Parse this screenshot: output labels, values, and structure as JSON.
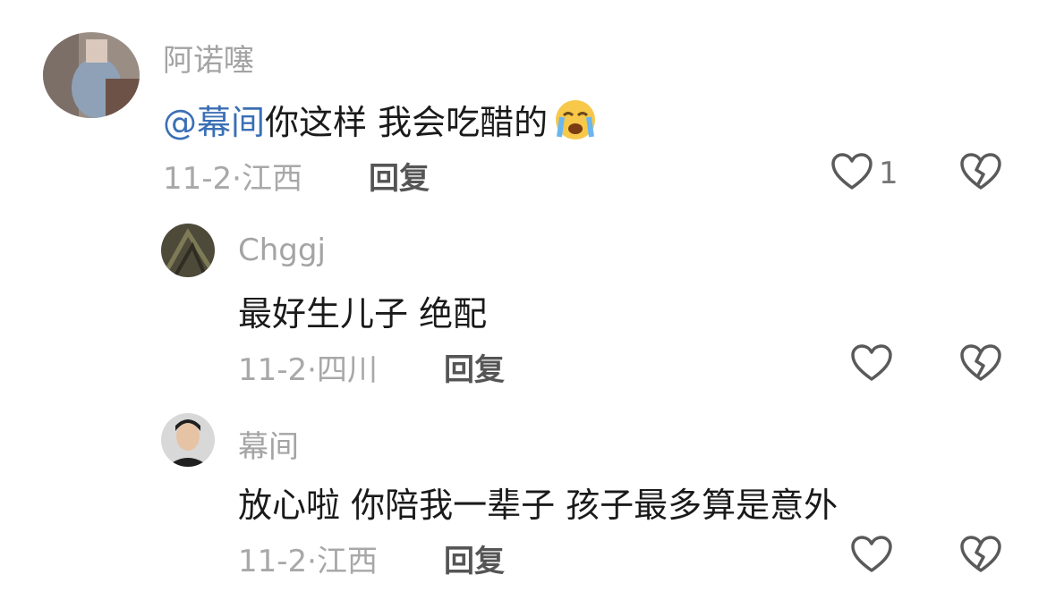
{
  "comments": [
    {
      "username": "阿诺噻",
      "mention": "@幕间",
      "text": "你这样 我会吃醋的",
      "emoji": "loudly-crying-face",
      "date": "11-2",
      "location": "江西",
      "reply_label": "回复",
      "like_count": "1"
    },
    {
      "username": "Chggj",
      "text": "最好生儿子  绝配",
      "date": "11-2",
      "location": "四川",
      "reply_label": "回复"
    },
    {
      "username": "幕间",
      "text": "放心啦  你陪我一辈子 孩子最多算是意外",
      "date": "11-2",
      "location": "江西",
      "reply_label": "回复"
    }
  ],
  "colors": {
    "mention": "#3b6fb6",
    "username": "#a4a4a4",
    "meta": "#a8a8a8",
    "icon": "#5a5a5a"
  }
}
